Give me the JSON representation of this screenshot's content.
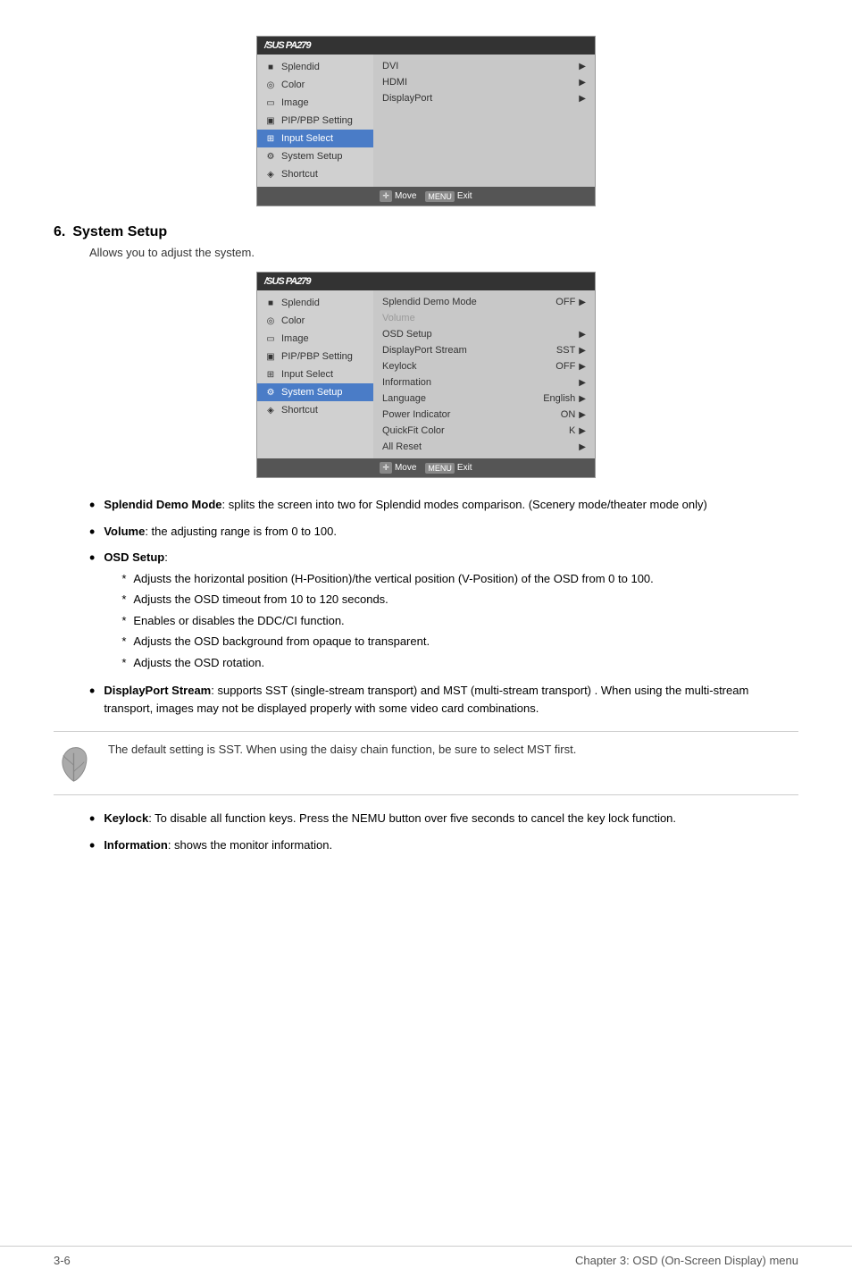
{
  "osd_top": {
    "title": "/SUS PA279",
    "left_items": [
      {
        "label": "Splendid",
        "icon": "■",
        "active": false
      },
      {
        "label": "Color",
        "icon": "◎",
        "active": false
      },
      {
        "label": "Image",
        "icon": "▭",
        "active": false
      },
      {
        "label": "PIP/PBP Setting",
        "icon": "▣",
        "active": false
      },
      {
        "label": "Input Select",
        "icon": "⊞",
        "active": true
      },
      {
        "label": "System Setup",
        "icon": "⚙",
        "active": false
      },
      {
        "label": "Shortcut",
        "icon": "◈",
        "active": false
      }
    ],
    "right_items": [
      {
        "label": "DVI",
        "value": "",
        "arrow": true
      },
      {
        "label": "HDMI",
        "value": "",
        "arrow": true
      },
      {
        "label": "DisplayPort",
        "value": "",
        "arrow": true
      }
    ],
    "footer": [
      {
        "icon": "✛",
        "label": "Move"
      },
      {
        "icon": "MENU",
        "label": "Exit"
      }
    ]
  },
  "section": {
    "number": "6.",
    "title": "System Setup",
    "description": "Allows you to adjust the system."
  },
  "osd_main": {
    "title": "/SUS PA279",
    "left_items": [
      {
        "label": "Splendid",
        "icon": "■",
        "active": false
      },
      {
        "label": "Color",
        "icon": "◎",
        "active": false
      },
      {
        "label": "Image",
        "icon": "▭",
        "active": false
      },
      {
        "label": "PIP/PBP Setting",
        "icon": "▣",
        "active": false
      },
      {
        "label": "Input Select",
        "icon": "⊞",
        "active": false
      },
      {
        "label": "System Setup",
        "icon": "⚙",
        "active": true
      },
      {
        "label": "Shortcut",
        "icon": "◈",
        "active": false
      }
    ],
    "right_items": [
      {
        "label": "Splendid Demo Mode",
        "value": "OFF",
        "arrow": true,
        "dimmed": false
      },
      {
        "label": "Volume",
        "value": "",
        "arrow": false,
        "dimmed": true
      },
      {
        "label": "OSD Setup",
        "value": "",
        "arrow": true,
        "dimmed": false
      },
      {
        "label": "DisplayPort Stream",
        "value": "SST",
        "arrow": true,
        "dimmed": false
      },
      {
        "label": "Keylock",
        "value": "OFF",
        "arrow": true,
        "dimmed": false
      },
      {
        "label": "Information",
        "value": "",
        "arrow": true,
        "dimmed": false
      },
      {
        "label": "Language",
        "value": "English",
        "arrow": true,
        "dimmed": false
      },
      {
        "label": "Power Indicator",
        "value": "ON",
        "arrow": true,
        "dimmed": false
      },
      {
        "label": "QuickFit Color",
        "value": "K",
        "arrow": true,
        "dimmed": false
      },
      {
        "label": "All Reset",
        "value": "",
        "arrow": true,
        "dimmed": false
      }
    ],
    "footer": [
      {
        "icon": "✛",
        "label": "Move"
      },
      {
        "icon": "MENU",
        "label": "Exit"
      }
    ]
  },
  "bullets": [
    {
      "term": "Splendid Demo Mode",
      "desc": ": splits the screen into two for Splendid modes comparison. (Scenery mode/theater mode only)"
    },
    {
      "term": "Volume",
      "desc": ": the adjusting range is from 0 to 100."
    },
    {
      "term": "OSD Setup",
      "desc": ":"
    },
    {
      "term": "DisplayPort Stream",
      "desc": ": supports SST (single-stream transport) and MST (multi-stream transport) . When using the multi-stream transport, images may not be displayed properly with some video card combinations."
    },
    {
      "term": "Keylock",
      "desc": ": To disable all function keys. Press the NEMU button over five seconds to cancel the key lock function."
    },
    {
      "term": "Information",
      "desc": ": shows the monitor information."
    }
  ],
  "osd_subitems": [
    "Adjusts the horizontal position (H-Position)/the vertical position (V-Position) of the OSD from 0 to 100.",
    "Adjusts the OSD timeout from 10 to 120 seconds.",
    "Enables or disables the DDC/CI function.",
    "Adjusts the OSD background from opaque to transparent.",
    "Adjusts the OSD rotation."
  ],
  "note": {
    "text": "The default setting is SST. When using the daisy chain function, be sure to select MST first."
  },
  "page_footer": {
    "left": "3-6",
    "right": "Chapter 3: OSD (On-Screen Display) menu"
  }
}
